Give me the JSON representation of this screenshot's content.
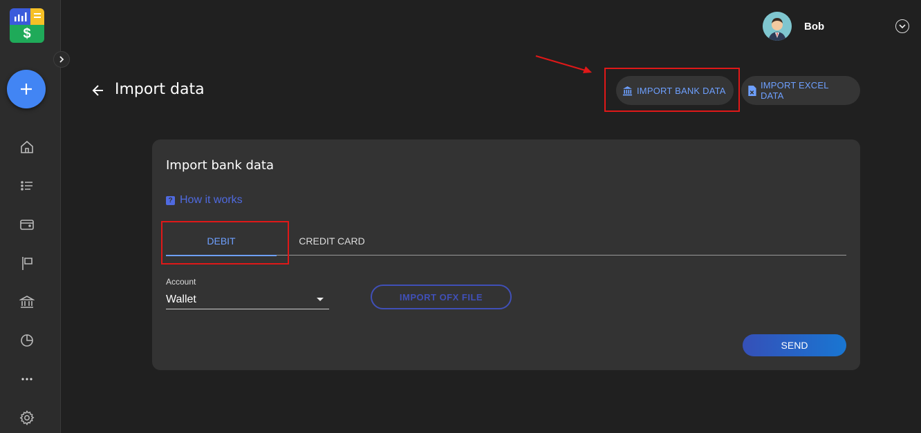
{
  "user": {
    "name": "Bob"
  },
  "page": {
    "title": "Import data"
  },
  "actions": {
    "import_bank": "IMPORT BANK DATA",
    "import_excel": "IMPORT EXCEL DATA"
  },
  "card": {
    "title": "Import bank data",
    "how_it_works": "How it works",
    "tabs": [
      "DEBIT",
      "CREDIT CARD"
    ],
    "active_tab": "DEBIT",
    "account_label": "Account",
    "account_value": "Wallet",
    "import_ofx": "IMPORT OFX FILE",
    "send": "SEND"
  },
  "sidebar": {
    "nav": [
      "home-icon",
      "list-icon",
      "wallet-icon",
      "flag-icon",
      "bank-icon",
      "pie-chart-icon",
      "more-icon",
      "settings-icon"
    ]
  },
  "colors": {
    "accent": "#6ea0ff",
    "fab": "#4285f4",
    "highlight": "#e01818",
    "outline_button": "#4050b8"
  }
}
